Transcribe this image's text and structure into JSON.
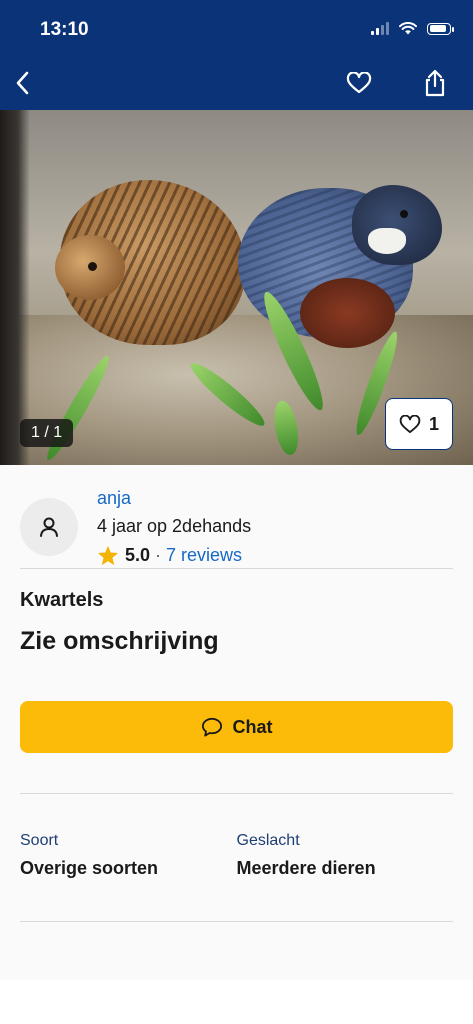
{
  "status_bar": {
    "time": "13:10"
  },
  "photo": {
    "counter": "1 / 1",
    "favorite_count": "1"
  },
  "seller": {
    "name": "anja",
    "member_since": "4 jaar op 2dehands",
    "rating": "5.0",
    "separator": "·",
    "reviews": "7 reviews"
  },
  "listing": {
    "category": "Kwartels",
    "headline": "Zie omschrijving",
    "chat_label": "Chat"
  },
  "attributes": [
    {
      "label": "Soort",
      "value": "Overige soorten"
    },
    {
      "label": "Geslacht",
      "value": "Meerdere dieren"
    }
  ],
  "colors": {
    "header": "#0b3478",
    "accent_button": "#fcbb09",
    "link": "#1569c7",
    "star": "#f5b301"
  },
  "icons": [
    "back-icon",
    "heart-icon",
    "share-icon",
    "user-icon",
    "star-icon",
    "chat-bubble-icon",
    "signal-icon",
    "wifi-icon",
    "battery-icon"
  ]
}
